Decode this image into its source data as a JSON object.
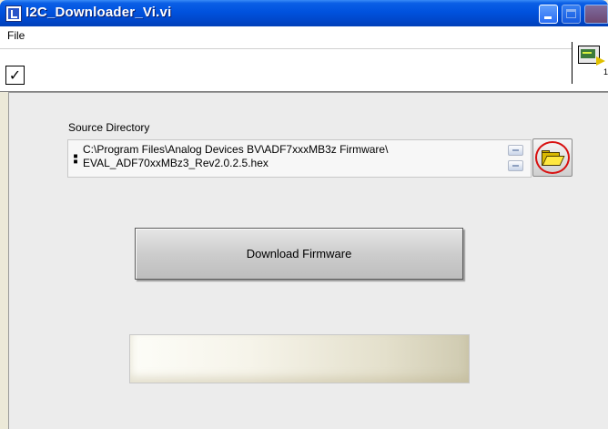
{
  "window": {
    "title": "I2C_Downloader_Vi.vi"
  },
  "menubar": {
    "items": [
      "File"
    ]
  },
  "toolbar": {
    "run_state_glyph": "✓"
  },
  "vi_icon": {
    "number": "1"
  },
  "panel": {
    "source_directory": {
      "label": "Source Directory",
      "path_value": "C:\\Program Files\\Analog Devices BV\\ADF7xxxMB3z Firmware\\\nEVAL_ADF70xxMBz3_Rev2.0.2.5.hex"
    },
    "download_button": {
      "label": "Download Firmware"
    },
    "progress": {
      "value": 0
    }
  },
  "colors": {
    "titlebar": "#0052de",
    "panel_bg": "#ececec",
    "highlight_circle": "#d81010",
    "folder": "#ffe840"
  }
}
